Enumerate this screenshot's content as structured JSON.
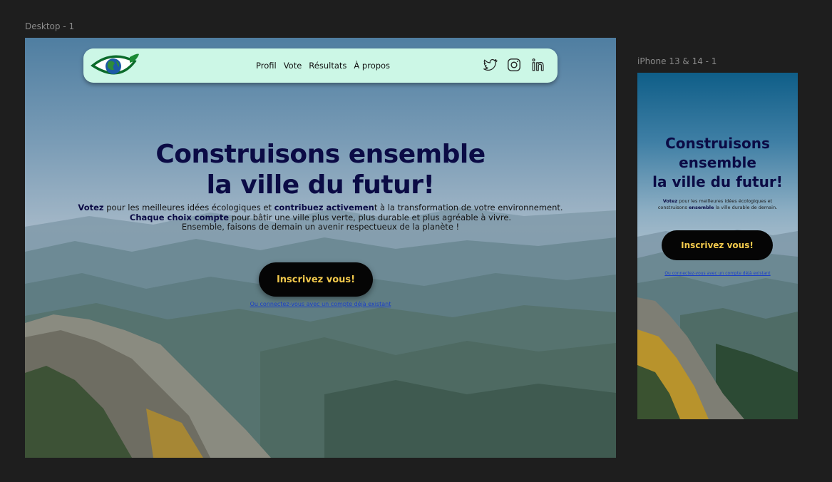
{
  "frames": {
    "desktop_label": "Desktop - 1",
    "mobile_label": "iPhone 13 & 14 - 1"
  },
  "nav": {
    "items": [
      {
        "label": "Profil"
      },
      {
        "label": "Vote"
      },
      {
        "label": "Résultats"
      },
      {
        "label": "À propos"
      }
    ],
    "social_icons": [
      "twitter-icon",
      "instagram-icon",
      "linkedin-icon"
    ]
  },
  "hero": {
    "title_line1": "Construisons ensemble",
    "title_line2": "la ville du futur!",
    "p1_bold1": "Votez",
    "p1_text1": " pour les meilleures idées écologiques et ",
    "p1_bold2": "contribuez activemen",
    "p1_text2": "t à la transformation de votre environnement.",
    "p2_bold": "Chaque choix compte",
    "p2_text": " pour bâtir une ville plus verte, plus durable et plus agréable à vivre.",
    "p3_text": "Ensemble, faisons de demain un avenir respectueux de la planète !",
    "cta_label": "Inscrivez vous!",
    "login_link": "Ou connectez-vous avec un compte déjà existant"
  },
  "mobile": {
    "title_line1": "Construisons",
    "title_line2": "ensemble",
    "title_line3": "la ville du futur!",
    "t1_bold": "Votez",
    "t1_text": " pour les meilleures idées écologiques et",
    "t2_text": "construisons ",
    "t2_bold": "ensemble",
    "t2_text2": " la ville durable de demain.",
    "cta_label": "Inscrivez vous!",
    "login_link": "Ou connectez-vous avec un compte déjà existant"
  },
  "colors": {
    "canvas": "#1e1e1e",
    "navbar": "#ccf7e6",
    "title": "#0b0b45",
    "cta_bg": "#050505",
    "cta_text": "#f2c94c",
    "link": "#1a3ec8"
  }
}
